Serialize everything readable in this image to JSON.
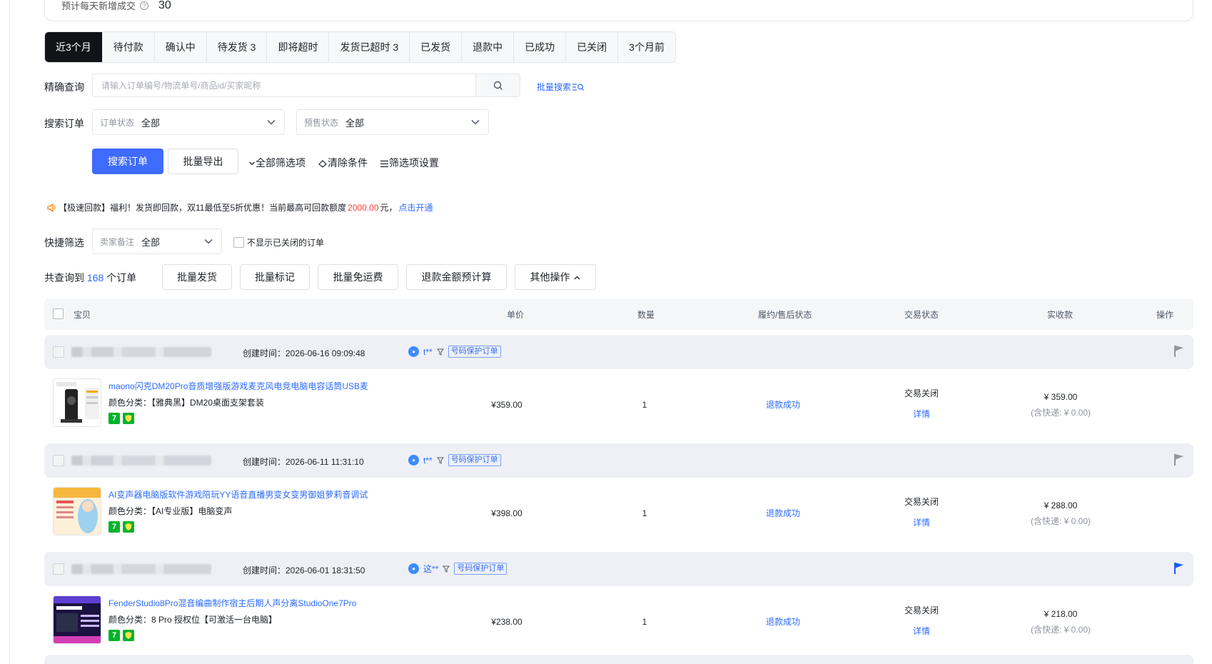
{
  "stats": {
    "label": "预计每天新增成交",
    "value": "30"
  },
  "tabs": [
    {
      "label": "近3个月",
      "active": true
    },
    {
      "label": "待付款"
    },
    {
      "label": "确认中"
    },
    {
      "label": "待发货 3"
    },
    {
      "label": "即将超时"
    },
    {
      "label": "发货已超时 3"
    },
    {
      "label": "已发货"
    },
    {
      "label": "退款中"
    },
    {
      "label": "已成功"
    },
    {
      "label": "已关闭"
    },
    {
      "label": "3个月前"
    }
  ],
  "search": {
    "label": "精确查询",
    "placeholder": "请输入订单编号/物流单号/商品id/买家昵称",
    "value": "",
    "batch_link": "批量搜索"
  },
  "filters": {
    "label": "搜索订单",
    "order_status": {
      "label": "订单状态",
      "value": "全部"
    },
    "presale_status": {
      "label": "预售状态",
      "value": "全部"
    }
  },
  "actions": {
    "search_button": "搜索订单",
    "export_button": "批量导出",
    "all_filters": "全部筛选项",
    "clear": "清除条件",
    "filter_settings": "筛选项设置"
  },
  "notice": {
    "prefix": "【极速回款】福利！发货即回款，双11最低至5折优惠！当前最高可回款额度",
    "amount": "2000.00",
    "suffix": "元，",
    "link": "点击开通"
  },
  "quick": {
    "label": "快捷筛选",
    "seller_note": {
      "label": "卖家备注",
      "value": "全部"
    },
    "hide_closed": "不显示已关闭的订单"
  },
  "summary": {
    "prefix": "共查询到",
    "count": "168",
    "suffix": "个订单",
    "buttons": [
      "批量发货",
      "批量标记",
      "批量免运费",
      "退款金额预计算",
      "其他操作"
    ]
  },
  "table_header": {
    "item": "宝贝",
    "unit_price": "单价",
    "quantity": "数量",
    "fulfillment": "履约/售后状态",
    "trade_status": "交易状态",
    "paid": "实收款",
    "ops": "操作"
  },
  "orders": [
    {
      "created": "创建时间：2026-06-16 09:09:48",
      "buyer": "t**",
      "tag": "号码保护订单",
      "flag_color": "#8f959e",
      "title": "maono闪克DM20Pro音质增强版游戏麦克风电竞电脑电容话筒USB麦",
      "spec": "颜色分类：【雅典黑】DM20桌面支架套装",
      "unit_price": "¥359.00",
      "quantity": "1",
      "fulfillment": "退款成功",
      "trade_status": "交易关闭",
      "detail": "详情",
      "paid": "¥ 359.00",
      "shipping": "(含快递: ¥ 0.00)"
    },
    {
      "created": "创建时间：2026-06-11 11:31:10",
      "buyer": "t**",
      "tag": "号码保护订单",
      "flag_color": "#8f959e",
      "title": "AI变声器电脑版软件游戏陪玩YY语音直播男变女变男御姐萝莉音调试",
      "spec": "颜色分类：【AI专业版】电脑变声",
      "unit_price": "¥398.00",
      "quantity": "1",
      "fulfillment": "退款成功",
      "trade_status": "交易关闭",
      "detail": "详情",
      "paid": "¥ 288.00",
      "shipping": "(含快递: ¥ 0.00)"
    },
    {
      "created": "创建时间：2026-06-01 18:31:50",
      "buyer": "这**",
      "tag": "号码保护订单",
      "flag_color": "#1a5cff",
      "title": "FenderStudio8Pro混音编曲制作宿主后期人声分离StudioOne7Pro",
      "spec": "颜色分类：8 Pro 授权位【可激活一台电脑】",
      "unit_price": "¥238.00",
      "quantity": "1",
      "fulfillment": "退款成功",
      "trade_status": "交易关闭",
      "detail": "详情",
      "paid": "¥ 218.00",
      "shipping": "(含快递: ¥ 0.00)"
    }
  ],
  "colors": {
    "primary": "#3f6bff",
    "link": "#2b6bff",
    "active_tab": "#111318",
    "highlight": "#f53f3f",
    "badge_green": "#00b42a"
  },
  "icons": [
    "help-icon",
    "search-icon",
    "chevron-down-icon",
    "filter-icon",
    "eraser-icon",
    "list-icon",
    "speaker-icon",
    "chevron-up-icon",
    "flag-icon",
    "shield-icon",
    "buyer-icon"
  ]
}
